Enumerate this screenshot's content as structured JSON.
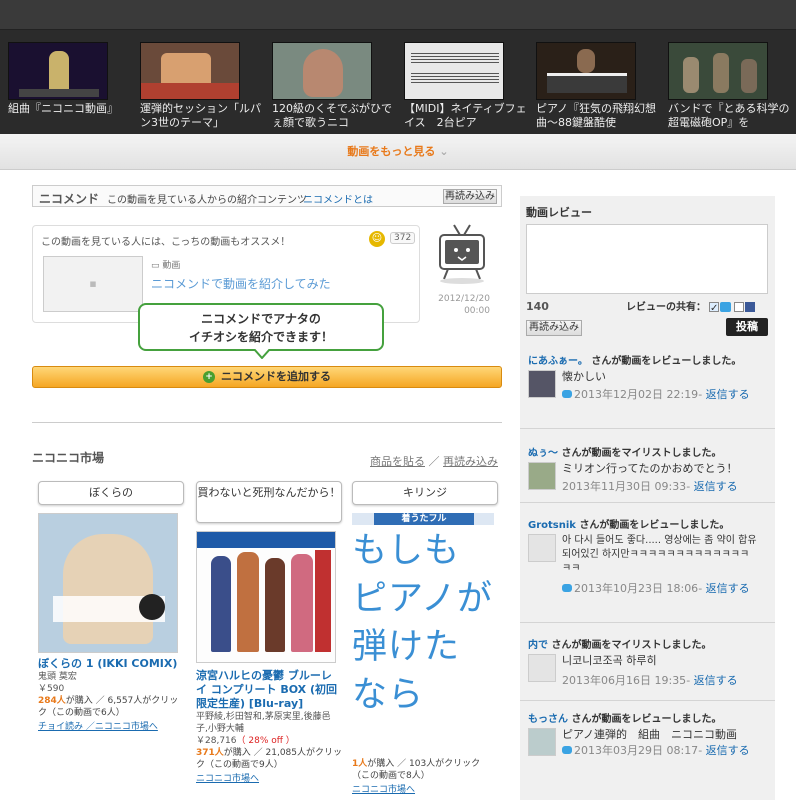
{
  "related_videos": [
    {
      "title": "組曲『ニコニコ動画』",
      "thumb": "nico-character"
    },
    {
      "title": "運弾的セッション「ルパン3世のテーマ」",
      "thumb": "performance"
    },
    {
      "title": "120級のくそでぶがひでぇ顔で歌うニコ",
      "thumb": "singer"
    },
    {
      "title": "【MIDI】ネイティブフェイス　2台ピア",
      "thumb": "sheet-music"
    },
    {
      "title": "ピアノ『狂気の飛翔幻想曲～88鍵盤酷使",
      "thumb": "piano"
    },
    {
      "title": "バンドで『とある科学の超電磁砲OP』を",
      "thumb": "band"
    }
  ],
  "more_videos_label": "動画をもっと見る",
  "nicommend": {
    "title": "ニコメンド",
    "subtitle": "この動画を見ている人からの紹介コンテンツ",
    "about_link": "ニコメンドとは",
    "reload_label": "再読み込み",
    "recommend_text": "この動画を見ている人には、こっちの動画もオススメ！",
    "count": "372",
    "category": "動画",
    "intro_link": "ニコメンドで動画を紹介してみた",
    "date": "2012/12/20",
    "time": "00:00",
    "bubble_line1": "ニコメンドでアナタの",
    "bubble_line2": "イチオシを紹介できます！",
    "add_button": "ニコメンドを追加する"
  },
  "market": {
    "title": "ニコニコ市場",
    "paste_link": "商品を貼る",
    "separator": "／",
    "reload_link": "再読み込み",
    "products": [
      {
        "label": "ぼくらの",
        "name": "ぼくらの 1 (IKKI COMIX)",
        "author": "鬼頭 莫宏",
        "price": "￥590",
        "bought": "284人",
        "stats_rest": "が購入 ／ 6,557人がクリック（この動画で6人）",
        "links": "チョイ読み ／ニコニコ市場へ"
      },
      {
        "label": "買わないと死刑なんだから！",
        "name": "涼宮ハルヒの憂鬱 ブルーレイ コンプリート BOX (初回限定生産) [Blu-ray]",
        "author": "平野綾,杉田智和,茅原実里,後藤邑子,小野大輔",
        "price": "￥28,716",
        "discount": "（ 28% off ）",
        "bought": "371人",
        "stats_rest": "が購入 ／ 21,085人がクリック（この動画で9人）",
        "links": "ニコニコ市場へ"
      },
      {
        "label": "キリンジ",
        "cover_banner": "着うたフル",
        "cover_text": "もしもピアノが弾けたなら",
        "bought": "1人",
        "stats_rest": "が購入 ／ 103人がクリック（この動画で8人）",
        "links": "ニコニコ市場へ"
      }
    ]
  },
  "review": {
    "title": "動画レビュー",
    "count": "140",
    "share_label": "レビューの共有：",
    "reload_label": "再読み込み",
    "post_label": "投稿",
    "activities": [
      {
        "user": "にあふぁー。",
        "action": "さんが動画をレビューしました。",
        "text": "懐かしい",
        "time": "2013年12月02日 22:19",
        "reply": "返信する"
      },
      {
        "user": "ぬぅ～",
        "action": "さんが動画をマイリストしました。",
        "text": "ミリオン行ってたのかおめでとう！",
        "time": "2013年11月30日 09:33",
        "reply": "返信する"
      },
      {
        "user": "Grotsnik",
        "action": "さんが動画をレビューしました。",
        "text": "아 다시 들어도 좋다..... 영상에는 좀 약이 합유되어있긴 하지만ㅋㅋㅋㅋㅋㅋㅋㅋㅋㅋㅋㅋㅋㅋㅋ",
        "time": "2013年10月23日 18:06",
        "reply": "返信する"
      },
      {
        "user": "内で",
        "action": "さんが動画をマイリストしました。",
        "text": "니코니코조곡 하루히",
        "time": "2013年06月16日 19:35",
        "reply": "返信する"
      },
      {
        "user": "もっさん",
        "action": "さんが動画をレビューしました。",
        "text": "ピアノ連弾的　組曲　ニコニコ動画",
        "time": "2013年03月29日 08:17",
        "reply": "返信する"
      }
    ]
  },
  "colors": {
    "accent": "#e8791a",
    "link": "#1a6bb0",
    "green": "#45a13e"
  }
}
